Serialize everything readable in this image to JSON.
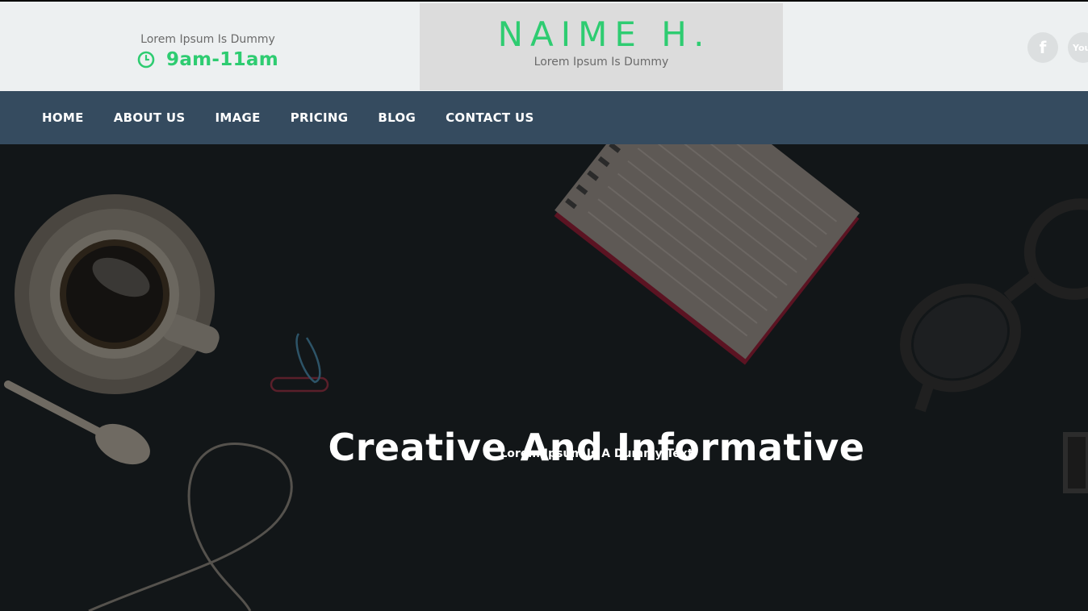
{
  "header": {
    "hours_caption": "Lorem Ipsum Is Dummy",
    "hours_value": "9am-11am",
    "brand_title": "NAIME H.",
    "brand_subtitle": "Lorem Ipsum Is Dummy",
    "social": {
      "facebook_glyph": "f",
      "youtube_glyph": "You"
    }
  },
  "nav": {
    "items": [
      {
        "label": "HOME"
      },
      {
        "label": "ABOUT US"
      },
      {
        "label": "IMAGE"
      },
      {
        "label": "PRICING"
      },
      {
        "label": "BLOG"
      },
      {
        "label": "CONTACT US"
      }
    ]
  },
  "hero": {
    "title": "Creative And Informative",
    "subtitle": "Lorem Ipsum Is A Dummy Text"
  },
  "colors": {
    "accent": "#2ecc71",
    "nav_bg": "#354b5f",
    "header_bg": "#edf0f1",
    "brand_box_bg": "#dcdcdc",
    "hero_bg": "#121618"
  },
  "icons": [
    "clock-icon",
    "facebook-icon",
    "youtube-icon"
  ]
}
